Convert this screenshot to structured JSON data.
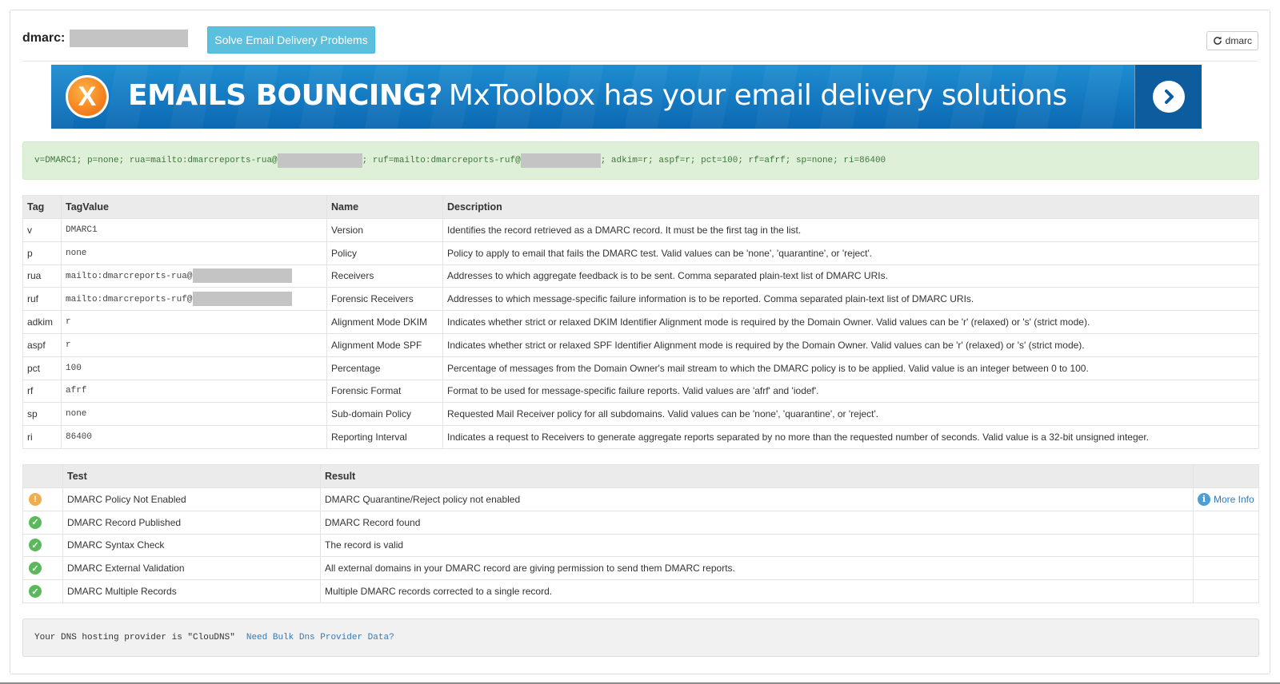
{
  "header": {
    "domain_prefix": "dmarc:",
    "solve_button": "Solve Email Delivery Problems",
    "refresh_button": "dmarc"
  },
  "banner": {
    "x_letter": "X",
    "headline": "EMAILS BOUNCING?",
    "tagline": "MxToolbox has your email delivery solutions"
  },
  "record": {
    "part1": "v=DMARC1; p=none; rua=mailto:dmarcreports-rua@",
    "part2": "; ruf=mailto:dmarcreports-ruf@",
    "part3": "; adkim=r; aspf=r; pct=100; rf=afrf; sp=none; ri=86400"
  },
  "tags_table": {
    "headers": [
      "Tag",
      "TagValue",
      "Name",
      "Description"
    ],
    "rows": [
      {
        "tag": "v",
        "value": "DMARC1",
        "name": "Version",
        "desc": "Identifies the record retrieved as a DMARC record. It must be the first tag in the list."
      },
      {
        "tag": "p",
        "value": "none",
        "name": "Policy",
        "desc": "Policy to apply to email that fails the DMARC test. Valid values can be 'none', 'quarantine', or 'reject'."
      },
      {
        "tag": "rua",
        "value": "mailto:dmarcreports-rua@",
        "name": "Receivers",
        "desc": "Addresses to which aggregate feedback is to be sent. Comma separated plain-text list of DMARC URIs."
      },
      {
        "tag": "ruf",
        "value": "mailto:dmarcreports-ruf@",
        "name": "Forensic Receivers",
        "desc": "Addresses to which message-specific failure information is to be reported. Comma separated plain-text list of DMARC URIs."
      },
      {
        "tag": "adkim",
        "value": "r",
        "name": "Alignment Mode DKIM",
        "desc": "Indicates whether strict or relaxed DKIM Identifier Alignment mode is required by the Domain Owner. Valid values can be 'r' (relaxed) or 's' (strict mode)."
      },
      {
        "tag": "aspf",
        "value": "r",
        "name": "Alignment Mode SPF",
        "desc": "Indicates whether strict or relaxed SPF Identifier Alignment mode is required by the Domain Owner. Valid values can be 'r' (relaxed) or 's' (strict mode)."
      },
      {
        "tag": "pct",
        "value": "100",
        "name": "Percentage",
        "desc": "Percentage of messages from the Domain Owner's mail stream to which the DMARC policy is to be applied. Valid value is an integer between 0 to 100."
      },
      {
        "tag": "rf",
        "value": "afrf",
        "name": "Forensic Format",
        "desc": "Format to be used for message-specific failure reports. Valid values are 'afrf' and 'iodef'."
      },
      {
        "tag": "sp",
        "value": "none",
        "name": "Sub-domain Policy",
        "desc": "Requested Mail Receiver policy for all subdomains. Valid values can be 'none', 'quarantine', or 'reject'."
      },
      {
        "tag": "ri",
        "value": "86400",
        "name": "Reporting Interval",
        "desc": "Indicates a request to Receivers to generate aggregate reports separated by no more than the requested number of seconds. Valid value is a 32-bit unsigned integer."
      }
    ]
  },
  "tests_table": {
    "headers": [
      "",
      "Test",
      "Result",
      ""
    ],
    "more_info_label": "More Info",
    "rows": [
      {
        "status": "warning",
        "icon_glyph": "!",
        "test": "DMARC Policy Not Enabled",
        "result": "DMARC Quarantine/Reject policy not enabled"
      },
      {
        "status": "ok",
        "icon_glyph": "✓",
        "test": "DMARC Record Published",
        "result": "DMARC Record found"
      },
      {
        "status": "ok",
        "icon_glyph": "✓",
        "test": "DMARC Syntax Check",
        "result": "The record is valid"
      },
      {
        "status": "ok",
        "icon_glyph": "✓",
        "test": "DMARC External Validation",
        "result": "All external domains in your DMARC record are giving permission to send them DMARC reports."
      },
      {
        "status": "ok",
        "icon_glyph": "✓",
        "test": "DMARC Multiple Records",
        "result": "Multiple DMARC records corrected to a single record."
      }
    ]
  },
  "dns": {
    "text": "Your DNS hosting provider is \"ClouDNS\"",
    "link": "Need Bulk Dns Provider Data?"
  },
  "colors": {
    "info_button": "#5bc0de",
    "success_box": "#dff0d8",
    "success_text": "#3c763d",
    "warning": "#f0ad4e",
    "ok": "#5cb85c",
    "link": "#337ab7",
    "banner_blue": "#1277c0",
    "banner_orange": "#f07c1a"
  }
}
